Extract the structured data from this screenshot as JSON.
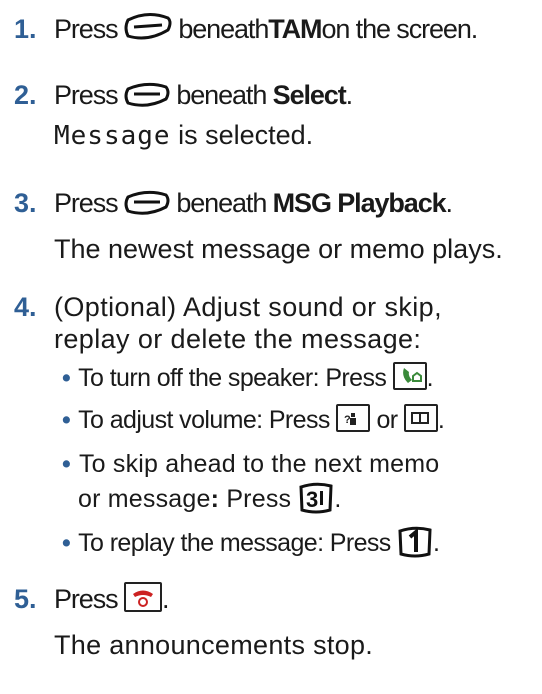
{
  "steps": [
    {
      "number": "1.",
      "pre": "Press",
      "mid": "beneath",
      "bold": "TAM",
      "post": "on the screen."
    },
    {
      "number": "2.",
      "pre": "Press",
      "mid": "beneath",
      "bold": "Select",
      "post": ".",
      "result_code": "Message",
      "result_text": "is selected."
    },
    {
      "number": "3.",
      "pre": "Press",
      "mid": "beneath",
      "bold": "MSG Playback",
      "post": ".",
      "result": "The newest message or memo plays."
    },
    {
      "number": "4.",
      "line1": "(Optional) Adjust sound or skip,",
      "line2": "replay or delete the message:",
      "bullets": [
        {
          "text": "To turn off the speaker: Press",
          "end": "."
        },
        {
          "text": "To adjust volume: Press",
          "mid": "or",
          "end": "."
        },
        {
          "text1": "To skip ahead to the next memo",
          "text2": "or message",
          "colon": ":",
          "press": "Press",
          "end": "."
        },
        {
          "text": "To replay the message: Press",
          "end": "."
        }
      ]
    },
    {
      "number": "5.",
      "pre": "Press",
      "end": ".",
      "result": "The announcements stop."
    }
  ],
  "icons": {
    "softkey_1": "softkey-icon",
    "softkey_2": "softkey-icon",
    "softkey_3": "softkey-icon",
    "speaker_key": "speaker-phone-icon",
    "volume_down_key": "directory-key-icon",
    "volume_up_key": "phonebook-key-icon",
    "key_3": "number-3-key-icon",
    "key_1": "number-1-key-icon",
    "off_key": "off-key-icon"
  },
  "colors": {
    "step_number": "#2f5f95",
    "bullet": "#2f5f95",
    "speaker_key": "#3a8a3a",
    "off_key": "#cc2222"
  }
}
